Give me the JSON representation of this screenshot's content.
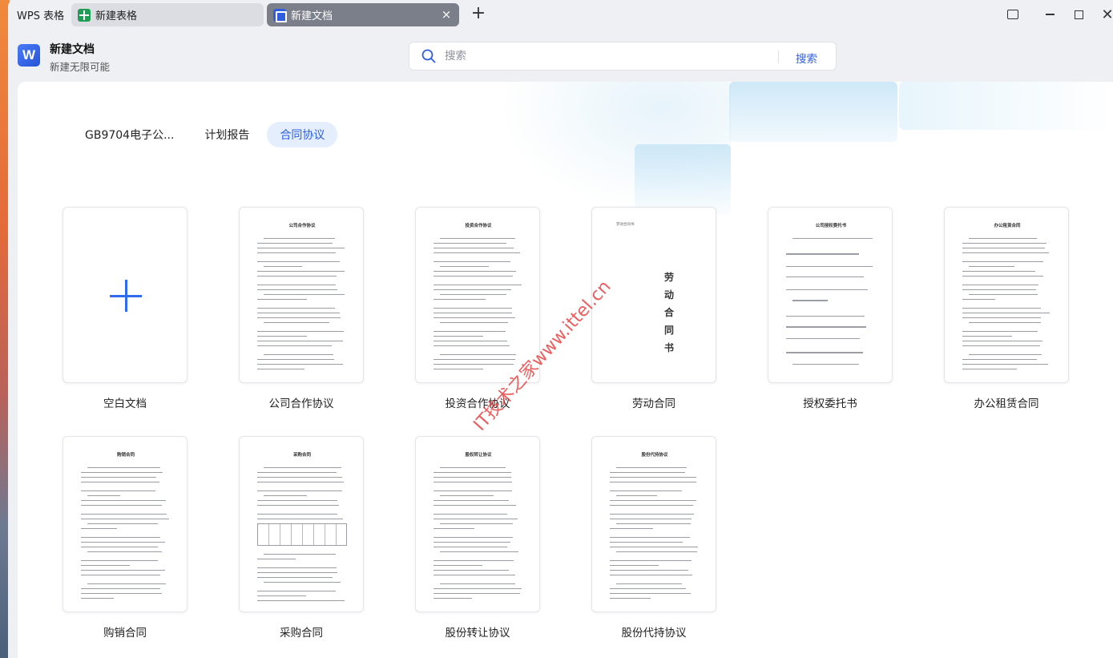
{
  "tabs": {
    "wps": "WPS 表格",
    "sheet": "新建表格",
    "doc": "新建文档",
    "close": "×",
    "add": "+"
  },
  "window_controls": {
    "close": "✕"
  },
  "header": {
    "logo": "W",
    "title": "新建文档",
    "subtitle": "新建无限可能"
  },
  "search": {
    "placeholder": "搜索",
    "button": "搜索"
  },
  "categories": [
    "GB9704电子公...",
    "计划报告",
    "合同协议"
  ],
  "active_category": 2,
  "templates": [
    {
      "label": "空白文档"
    },
    {
      "label": "公司合作协议",
      "thumb_title": "公司合作协议"
    },
    {
      "label": "投资合作协议",
      "thumb_title": "投资合作协议"
    },
    {
      "label": "劳动合同",
      "thumb_title": "劳动合同书",
      "vertical": [
        "劳",
        "动",
        "合",
        "同",
        "书"
      ]
    },
    {
      "label": "授权委托书",
      "thumb_title": "公司授权委托书"
    },
    {
      "label": "办公租赁合同",
      "thumb_title": "办公租赁合同"
    },
    {
      "label": "购销合同",
      "thumb_title": "购销合同"
    },
    {
      "label": "采购合同",
      "thumb_title": "采购合同"
    },
    {
      "label": "股份转让协议",
      "thumb_title": "股权转让协议"
    },
    {
      "label": "股份代持协议",
      "thumb_title": "股份代持协议"
    }
  ],
  "watermark": "IT技术之家www.ittel.cn",
  "colors": {
    "accent": "#2f5fe0",
    "active_tab_bg": "#e4eefd",
    "doc_tab_bg": "#7b7f8a"
  }
}
